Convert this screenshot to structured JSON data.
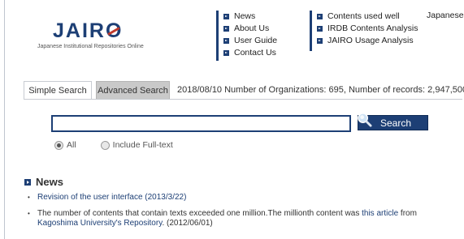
{
  "logo": {
    "wordmark": "JAIRO",
    "subtitle": "Japanese Institutional Repositories Online"
  },
  "nav": {
    "col1": [
      "News",
      "About Us",
      "User Guide",
      "Contact Us"
    ],
    "col2": [
      "Contents used well",
      "IRDB Contents Analysis",
      "JAIRO Usage Analysis"
    ],
    "language": "Japanese"
  },
  "tabs": {
    "simple": "Simple Search",
    "advanced": "Advanced Search"
  },
  "stats": "2018/08/10 Number of Organizations:  695, Number of records:  2,947,500",
  "search": {
    "value": "",
    "button": "Search"
  },
  "options": {
    "all": "All",
    "fulltext": "Include Full-text",
    "selected": "All"
  },
  "news": {
    "heading": "News",
    "item1_link": "Revision of the user interface (2013/3/22)",
    "item2_text": "The number of contents that contain texts exceeded one million.The millionth content was ",
    "item2_link1": "this article",
    "item2_mid": " from ",
    "item2_link2": "Kagoshima University's Repository",
    "item2_tail": ". (2012/06/01)"
  },
  "colors": {
    "brand": "#1d3f75",
    "accent": "#c0392b"
  }
}
